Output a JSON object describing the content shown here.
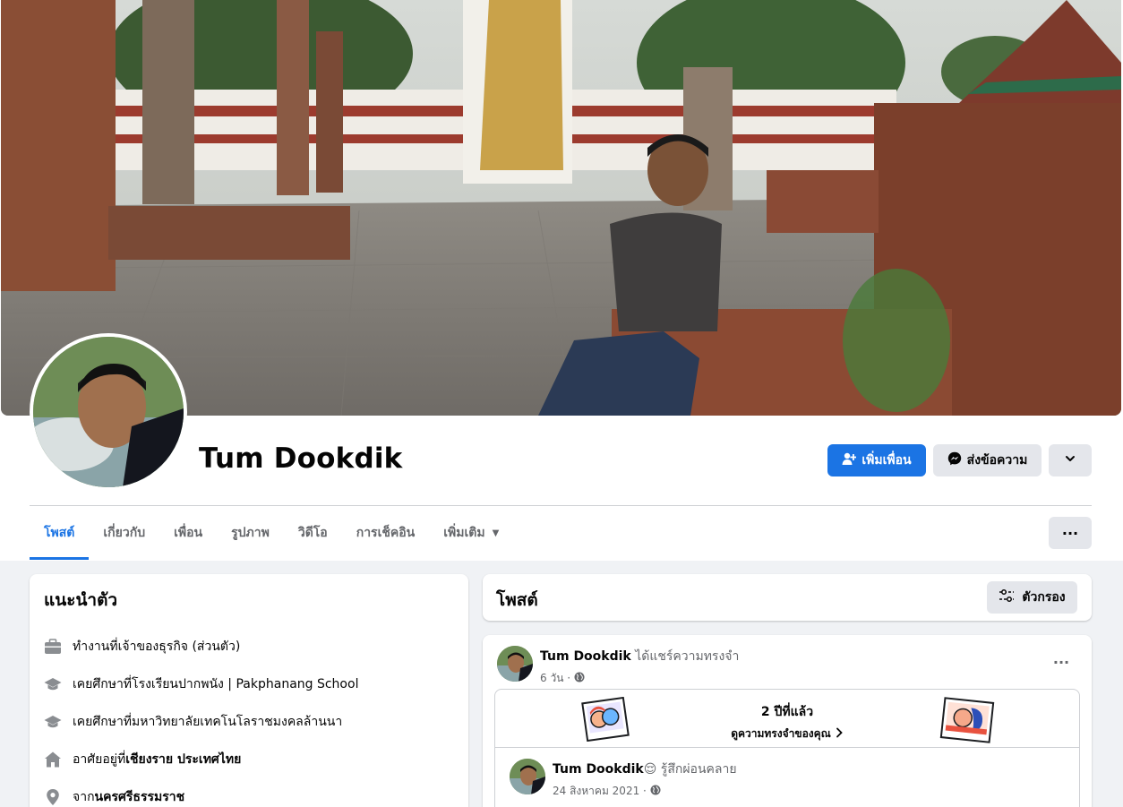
{
  "profile": {
    "name": "Tum Dookdik"
  },
  "actions": {
    "add_friend": "เพิ่มเพื่อน",
    "message": "ส่งข้อความ"
  },
  "tabs": [
    {
      "label": "โพสต์"
    },
    {
      "label": "เกี่ยวกับ"
    },
    {
      "label": "เพื่อน"
    },
    {
      "label": "รูปภาพ"
    },
    {
      "label": "วิดีโอ"
    },
    {
      "label": "การเช็คอิน"
    },
    {
      "label": "เพิ่มเติม"
    }
  ],
  "intro": {
    "title": "แนะนำตัว",
    "items": [
      {
        "icon": "briefcase-icon",
        "prefix": "ทำงานที่ ",
        "value": "เจ้าของธุรกิจ (ส่วนตัว)",
        "bold": false
      },
      {
        "icon": "graduation-cap-icon",
        "prefix": "เคยศึกษาที่ ",
        "value": "โรงเรียนปากพนัง | Pakphanang School",
        "bold": false
      },
      {
        "icon": "graduation-cap-icon",
        "prefix": "เคยศึกษาที่ ",
        "value": "มหาวิทยาลัยเทคโนโลราชมงคลล้านนา",
        "bold": false
      },
      {
        "icon": "home-icon",
        "prefix": "อาศัยอยู่ที่ ",
        "value": "เชียงราย ประเทศไทย",
        "bold": true
      },
      {
        "icon": "location-pin-icon",
        "prefix": "จาก ",
        "value": "นครศรีธรรมราช",
        "bold": true
      }
    ]
  },
  "posts_header": {
    "title": "โพสต์",
    "filter_label": "ตัวกรอง"
  },
  "post": {
    "author": "Tum Dookdik",
    "action": " ได้แชร์ความทรงจำ",
    "time": "6 วัน ·",
    "memory": {
      "title": "2 ปีที่แล้ว",
      "link": "ดูความทรงจำของคุณ"
    },
    "shared": {
      "author": "Tum Dookdik",
      "emoji": "😌",
      "feeling": " รู้สึกผ่อนคลาย",
      "time": "24 สิงหาคม 2021 ·"
    }
  },
  "colors": {
    "accent": "#1b74e4",
    "background": "#f0f2f5",
    "secondary_button": "#e4e6eb"
  }
}
